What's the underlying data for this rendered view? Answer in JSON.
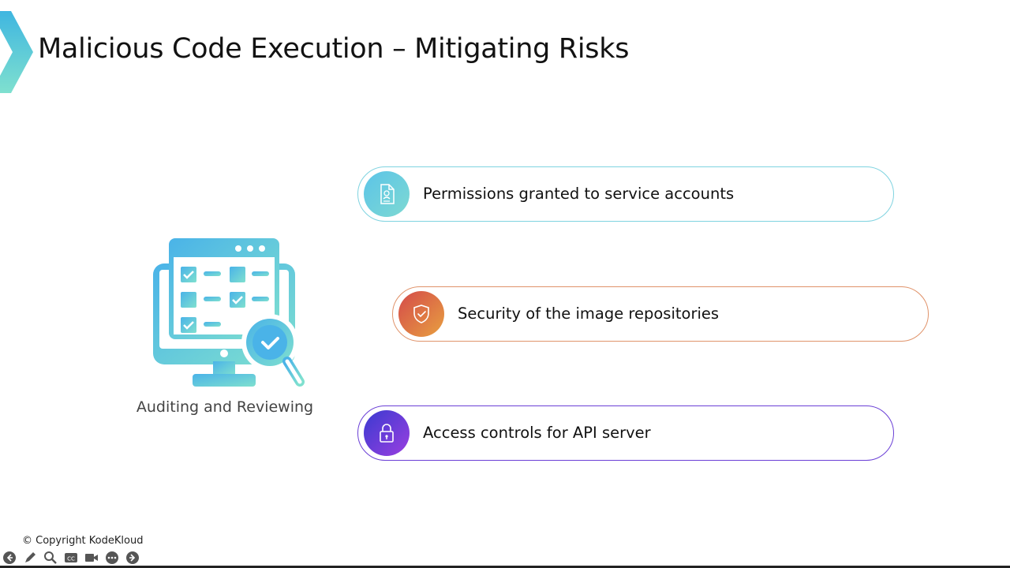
{
  "slide": {
    "title": "Malicious Code Execution – Mitigating Risks",
    "illustration_caption": "Auditing and Reviewing",
    "items": [
      {
        "label": "Permissions granted to service accounts",
        "icon": "document-icon"
      },
      {
        "label": "Security of the image repositories",
        "icon": "shield-check-icon"
      },
      {
        "label": "Access controls for API server",
        "icon": "lock-icon"
      }
    ],
    "copyright": "© Copyright KodeKloud"
  },
  "colors": {
    "accent_teal": "#5bc4e8",
    "accent_orange": "#e0936a",
    "accent_purple": "#6a3fd6"
  },
  "toolbar": {
    "icons": [
      "back-arrow-icon",
      "pen-icon",
      "zoom-icon",
      "cc-icon",
      "video-icon",
      "more-icon",
      "forward-arrow-icon"
    ]
  }
}
